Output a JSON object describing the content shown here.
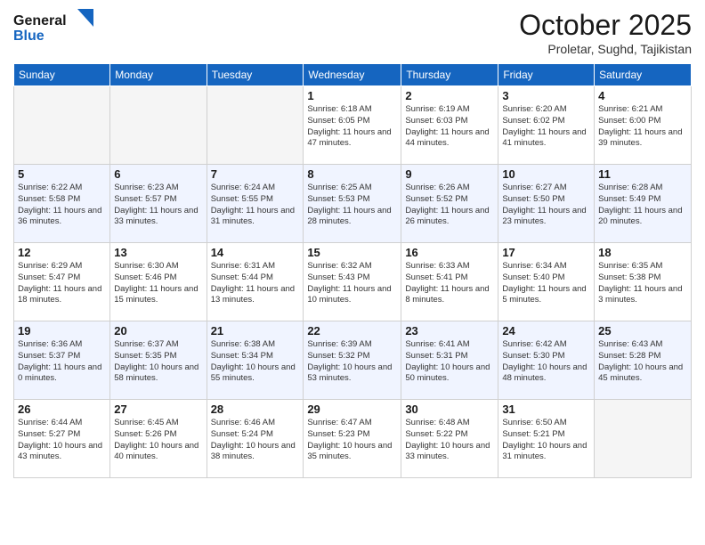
{
  "logo": {
    "general": "General",
    "blue": "Blue"
  },
  "title": "October 2025",
  "location": "Proletar, Sughd, Tajikistan",
  "headers": [
    "Sunday",
    "Monday",
    "Tuesday",
    "Wednesday",
    "Thursday",
    "Friday",
    "Saturday"
  ],
  "weeks": [
    [
      {
        "day": "",
        "info": ""
      },
      {
        "day": "",
        "info": ""
      },
      {
        "day": "",
        "info": ""
      },
      {
        "day": "1",
        "info": "Sunrise: 6:18 AM\nSunset: 6:05 PM\nDaylight: 11 hours and 47 minutes."
      },
      {
        "day": "2",
        "info": "Sunrise: 6:19 AM\nSunset: 6:03 PM\nDaylight: 11 hours and 44 minutes."
      },
      {
        "day": "3",
        "info": "Sunrise: 6:20 AM\nSunset: 6:02 PM\nDaylight: 11 hours and 41 minutes."
      },
      {
        "day": "4",
        "info": "Sunrise: 6:21 AM\nSunset: 6:00 PM\nDaylight: 11 hours and 39 minutes."
      }
    ],
    [
      {
        "day": "5",
        "info": "Sunrise: 6:22 AM\nSunset: 5:58 PM\nDaylight: 11 hours and 36 minutes."
      },
      {
        "day": "6",
        "info": "Sunrise: 6:23 AM\nSunset: 5:57 PM\nDaylight: 11 hours and 33 minutes."
      },
      {
        "day": "7",
        "info": "Sunrise: 6:24 AM\nSunset: 5:55 PM\nDaylight: 11 hours and 31 minutes."
      },
      {
        "day": "8",
        "info": "Sunrise: 6:25 AM\nSunset: 5:53 PM\nDaylight: 11 hours and 28 minutes."
      },
      {
        "day": "9",
        "info": "Sunrise: 6:26 AM\nSunset: 5:52 PM\nDaylight: 11 hours and 26 minutes."
      },
      {
        "day": "10",
        "info": "Sunrise: 6:27 AM\nSunset: 5:50 PM\nDaylight: 11 hours and 23 minutes."
      },
      {
        "day": "11",
        "info": "Sunrise: 6:28 AM\nSunset: 5:49 PM\nDaylight: 11 hours and 20 minutes."
      }
    ],
    [
      {
        "day": "12",
        "info": "Sunrise: 6:29 AM\nSunset: 5:47 PM\nDaylight: 11 hours and 18 minutes."
      },
      {
        "day": "13",
        "info": "Sunrise: 6:30 AM\nSunset: 5:46 PM\nDaylight: 11 hours and 15 minutes."
      },
      {
        "day": "14",
        "info": "Sunrise: 6:31 AM\nSunset: 5:44 PM\nDaylight: 11 hours and 13 minutes."
      },
      {
        "day": "15",
        "info": "Sunrise: 6:32 AM\nSunset: 5:43 PM\nDaylight: 11 hours and 10 minutes."
      },
      {
        "day": "16",
        "info": "Sunrise: 6:33 AM\nSunset: 5:41 PM\nDaylight: 11 hours and 8 minutes."
      },
      {
        "day": "17",
        "info": "Sunrise: 6:34 AM\nSunset: 5:40 PM\nDaylight: 11 hours and 5 minutes."
      },
      {
        "day": "18",
        "info": "Sunrise: 6:35 AM\nSunset: 5:38 PM\nDaylight: 11 hours and 3 minutes."
      }
    ],
    [
      {
        "day": "19",
        "info": "Sunrise: 6:36 AM\nSunset: 5:37 PM\nDaylight: 11 hours and 0 minutes."
      },
      {
        "day": "20",
        "info": "Sunrise: 6:37 AM\nSunset: 5:35 PM\nDaylight: 10 hours and 58 minutes."
      },
      {
        "day": "21",
        "info": "Sunrise: 6:38 AM\nSunset: 5:34 PM\nDaylight: 10 hours and 55 minutes."
      },
      {
        "day": "22",
        "info": "Sunrise: 6:39 AM\nSunset: 5:32 PM\nDaylight: 10 hours and 53 minutes."
      },
      {
        "day": "23",
        "info": "Sunrise: 6:41 AM\nSunset: 5:31 PM\nDaylight: 10 hours and 50 minutes."
      },
      {
        "day": "24",
        "info": "Sunrise: 6:42 AM\nSunset: 5:30 PM\nDaylight: 10 hours and 48 minutes."
      },
      {
        "day": "25",
        "info": "Sunrise: 6:43 AM\nSunset: 5:28 PM\nDaylight: 10 hours and 45 minutes."
      }
    ],
    [
      {
        "day": "26",
        "info": "Sunrise: 6:44 AM\nSunset: 5:27 PM\nDaylight: 10 hours and 43 minutes."
      },
      {
        "day": "27",
        "info": "Sunrise: 6:45 AM\nSunset: 5:26 PM\nDaylight: 10 hours and 40 minutes."
      },
      {
        "day": "28",
        "info": "Sunrise: 6:46 AM\nSunset: 5:24 PM\nDaylight: 10 hours and 38 minutes."
      },
      {
        "day": "29",
        "info": "Sunrise: 6:47 AM\nSunset: 5:23 PM\nDaylight: 10 hours and 35 minutes."
      },
      {
        "day": "30",
        "info": "Sunrise: 6:48 AM\nSunset: 5:22 PM\nDaylight: 10 hours and 33 minutes."
      },
      {
        "day": "31",
        "info": "Sunrise: 6:50 AM\nSunset: 5:21 PM\nDaylight: 10 hours and 31 minutes."
      },
      {
        "day": "",
        "info": ""
      }
    ]
  ]
}
